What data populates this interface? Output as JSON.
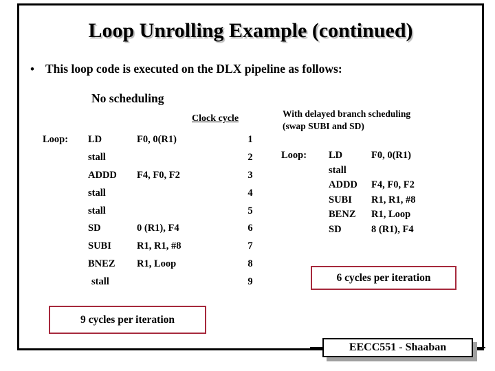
{
  "slide": {
    "title": "Loop Unrolling Example (continued)",
    "bullet_marker": "•",
    "bullet_text": "This loop code is executed on the DLX pipeline as follows:",
    "accent_color": "#a6293c",
    "frame_color": "#000000"
  },
  "left_section": {
    "heading": "No scheduling",
    "cycle_column_header": "Clock cycle",
    "rows": [
      {
        "label": "Loop:",
        "op": "LD",
        "args": "F0, 0(R1)",
        "cycle": "1",
        "indent": false
      },
      {
        "label": "",
        "op": "stall",
        "args": "",
        "cycle": "2",
        "indent": false
      },
      {
        "label": "",
        "op": "ADDD",
        "args": "F4, F0, F2",
        "cycle": "3",
        "indent": false
      },
      {
        "label": "",
        "op": "stall",
        "args": "",
        "cycle": "4",
        "indent": false
      },
      {
        "label": "",
        "op": "stall",
        "args": "",
        "cycle": "5",
        "indent": false
      },
      {
        "label": "",
        "op": "SD",
        "args": "0 (R1), F4",
        "cycle": "6",
        "indent": false
      },
      {
        "label": "",
        "op": "SUBI",
        "args": "R1, R1, #8",
        "cycle": "7",
        "indent": false
      },
      {
        "label": "",
        "op": "BNEZ",
        "args": "R1, Loop",
        "cycle": "8",
        "indent": false
      },
      {
        "label": "",
        "op": "stall",
        "args": "",
        "cycle": "9",
        "indent": true
      }
    ],
    "summary_box": "9 cycles per iteration"
  },
  "right_section": {
    "heading_line1": "With delayed branch scheduling",
    "heading_line2": "(swap SUBI and SD)",
    "rows": [
      {
        "label": "Loop:",
        "op": "LD",
        "args": "F0, 0(R1)"
      },
      {
        "label": "",
        "op": "stall",
        "args": ""
      },
      {
        "label": "",
        "op": "ADDD",
        "args": "F4, F0, F2"
      },
      {
        "label": "",
        "op": "SUBI",
        "args": "R1, R1, #8"
      },
      {
        "label": "",
        "op": "BENZ",
        "args": "R1, Loop"
      },
      {
        "label": "",
        "op": "SD",
        "args": "8 (R1), F4"
      }
    ],
    "summary_box": "6 cycles per iteration"
  },
  "footer": {
    "badge_text": "EECC551 - Shaaban"
  }
}
